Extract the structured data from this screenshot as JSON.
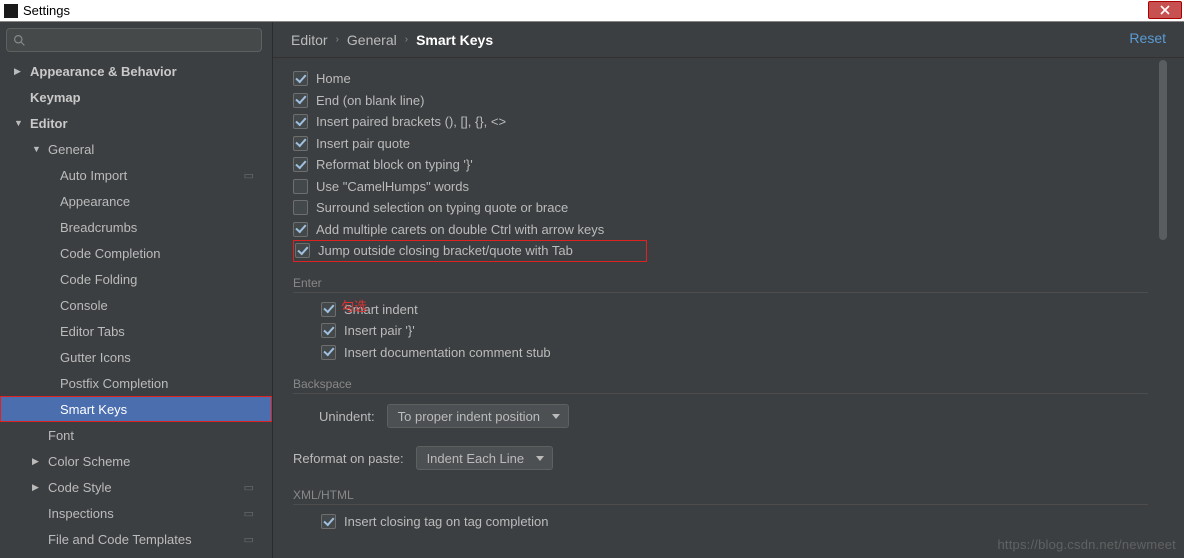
{
  "window": {
    "title": "Settings"
  },
  "search": {
    "placeholder": ""
  },
  "tree": {
    "appearance_behavior": "Appearance & Behavior",
    "keymap": "Keymap",
    "editor": "Editor",
    "general": "General",
    "auto_import": "Auto Import",
    "appearance": "Appearance",
    "breadcrumbs": "Breadcrumbs",
    "code_completion": "Code Completion",
    "code_folding": "Code Folding",
    "console": "Console",
    "editor_tabs": "Editor Tabs",
    "gutter_icons": "Gutter Icons",
    "postfix_completion": "Postfix Completion",
    "smart_keys": "Smart Keys",
    "font": "Font",
    "color_scheme": "Color Scheme",
    "code_style": "Code Style",
    "inspections": "Inspections",
    "file_code_templates": "File and Code Templates"
  },
  "breadcrumb": {
    "seg1": "Editor",
    "seg2": "General",
    "seg3": "Smart Keys"
  },
  "reset": "Reset",
  "checks": {
    "home": "Home",
    "end_blank": "End (on blank line)",
    "insert_paired_brackets": "Insert paired brackets (), [], {}, <>",
    "insert_pair_quote": "Insert pair quote",
    "reformat_block": "Reformat block on typing '}'",
    "camel_humps": "Use \"CamelHumps\" words",
    "surround_selection": "Surround selection on typing quote or brace",
    "multiple_carets": "Add multiple carets on double Ctrl with arrow keys",
    "jump_outside": "Jump outside closing bracket/quote with Tab"
  },
  "annotation": "勾选",
  "groups": {
    "enter": "Enter",
    "backspace": "Backspace",
    "xml_html": "XML/HTML"
  },
  "enter": {
    "smart_indent": "Smart indent",
    "insert_pair_brace": "Insert pair '}'",
    "insert_doc_stub": "Insert documentation comment stub"
  },
  "backspace": {
    "unindent_label": "Unindent:",
    "unindent_value": "To proper indent position"
  },
  "reformat_paste": {
    "label": "Reformat on paste:",
    "value": "Indent Each Line"
  },
  "xml": {
    "insert_closing": "Insert closing tag on tag completion"
  },
  "watermark": "https://blog.csdn.net/newmeet"
}
